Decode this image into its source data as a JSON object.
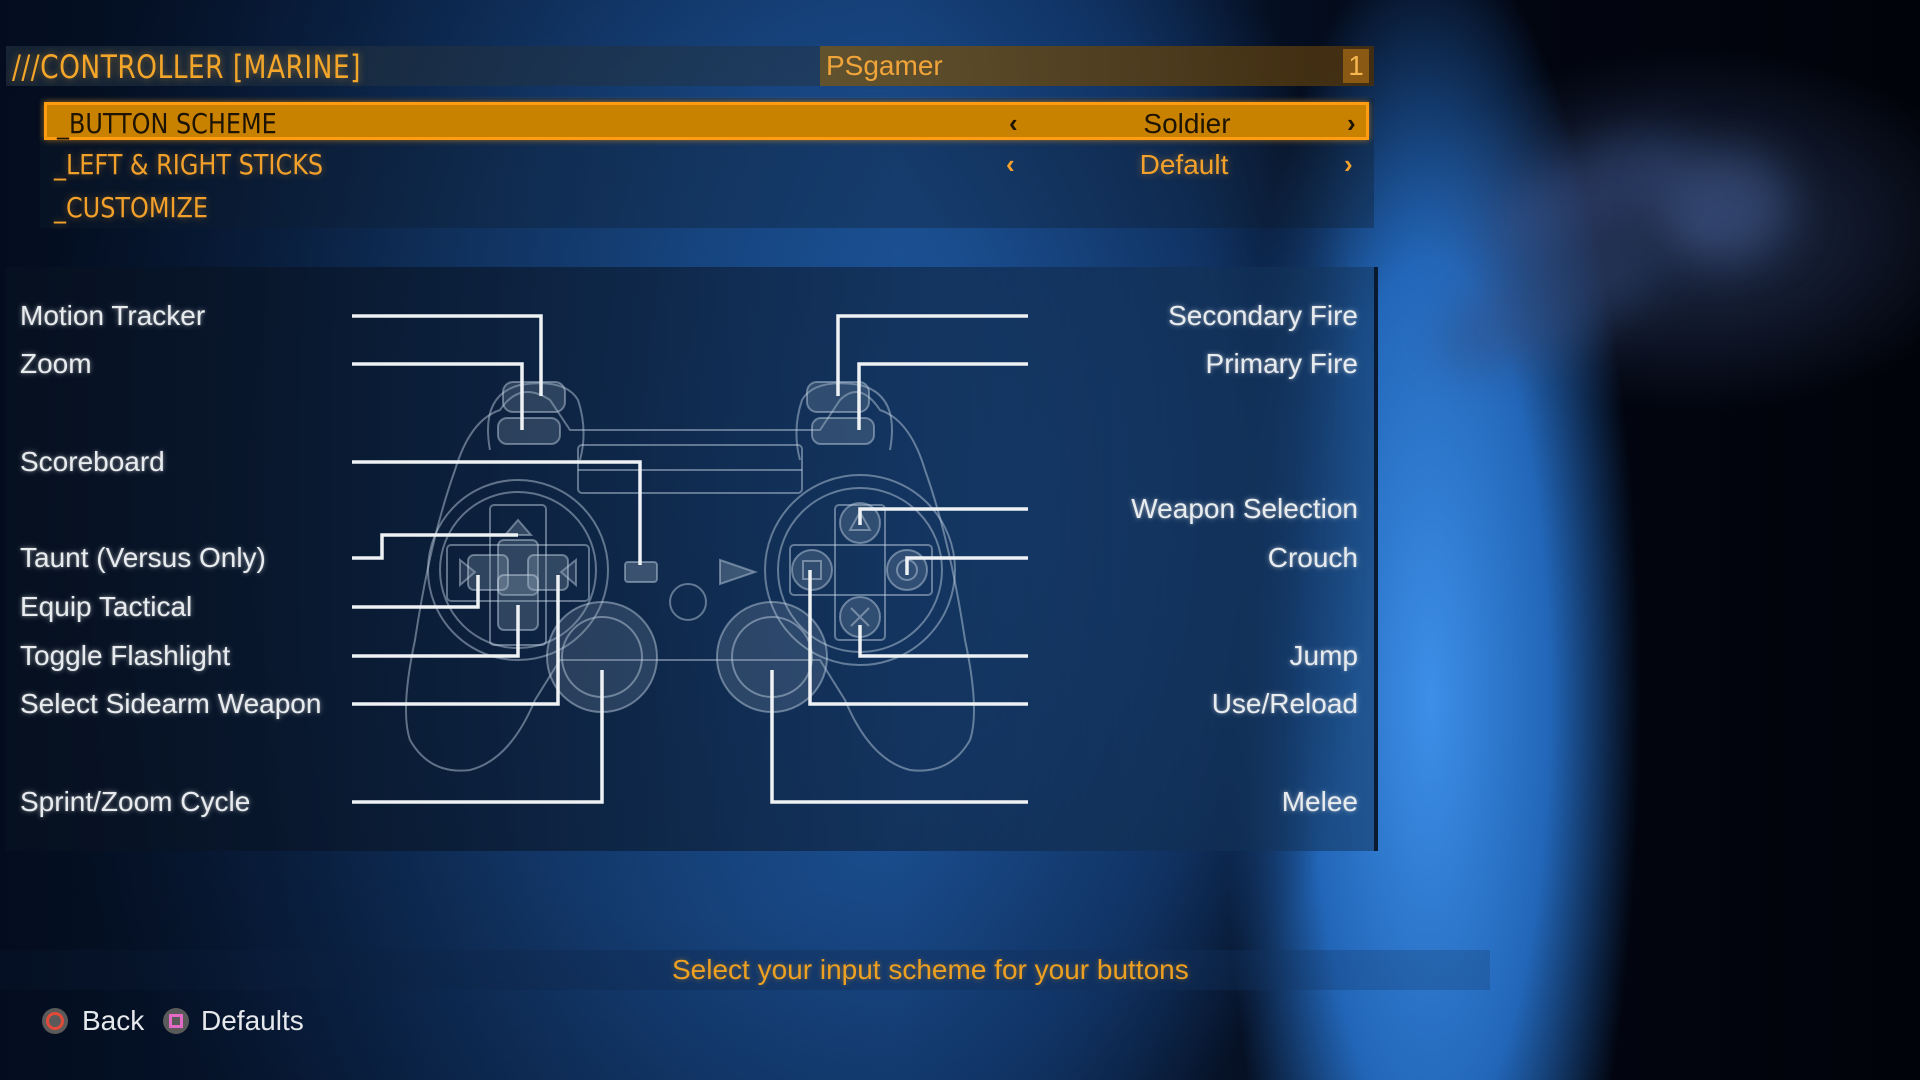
{
  "header": {
    "title": "///CONTROLLER [MARINE]",
    "profile_name": "PSgamer",
    "player_number": "1"
  },
  "menu": {
    "items": [
      {
        "label": "_BUTTON SCHEME",
        "value": "Soldier",
        "has_options": true,
        "selected": true
      },
      {
        "label": "_LEFT & RIGHT STICKS",
        "value": "Default",
        "has_options": true,
        "selected": false
      },
      {
        "label": "_CUSTOMIZE",
        "value": null,
        "has_options": false,
        "selected": false
      }
    ],
    "prev_arrow": "‹",
    "next_arrow": "›"
  },
  "mapping": {
    "controller_icon": "ps3-controller-diagram",
    "left": [
      {
        "label": "Motion Tracker",
        "button": "L2"
      },
      {
        "label": "Zoom",
        "button": "L1"
      },
      {
        "label": "Scoreboard",
        "button": "Select"
      },
      {
        "label": "Taunt (Versus Only)",
        "button": "D-Pad Up"
      },
      {
        "label": "Equip Tactical",
        "button": "D-Pad Left"
      },
      {
        "label": "Toggle Flashlight",
        "button": "D-Pad Down"
      },
      {
        "label": "Select Sidearm Weapon",
        "button": "D-Pad Right"
      },
      {
        "label": "Sprint/Zoom Cycle",
        "button": "L3"
      }
    ],
    "right": [
      {
        "label": "Secondary Fire",
        "button": "R2"
      },
      {
        "label": "Primary Fire",
        "button": "R1"
      },
      {
        "label": "Weapon Selection",
        "button": "Triangle"
      },
      {
        "label": "Crouch",
        "button": "Circle"
      },
      {
        "label": "Jump",
        "button": "Cross"
      },
      {
        "label": "Use/Reload",
        "button": "Square"
      },
      {
        "label": "Melee",
        "button": "R3"
      }
    ]
  },
  "hint": "Select your input scheme for your buttons",
  "footer": {
    "back": {
      "icon": "circle-button-icon",
      "label": "Back"
    },
    "defaults": {
      "icon": "square-button-icon",
      "label": "Defaults"
    }
  },
  "colors": {
    "accent": "#f3a12a",
    "selected_fill": "#c98200",
    "selected_border": "#ff9c12",
    "circle_button": "#e24a3a",
    "square_button": "#e46ac8"
  }
}
